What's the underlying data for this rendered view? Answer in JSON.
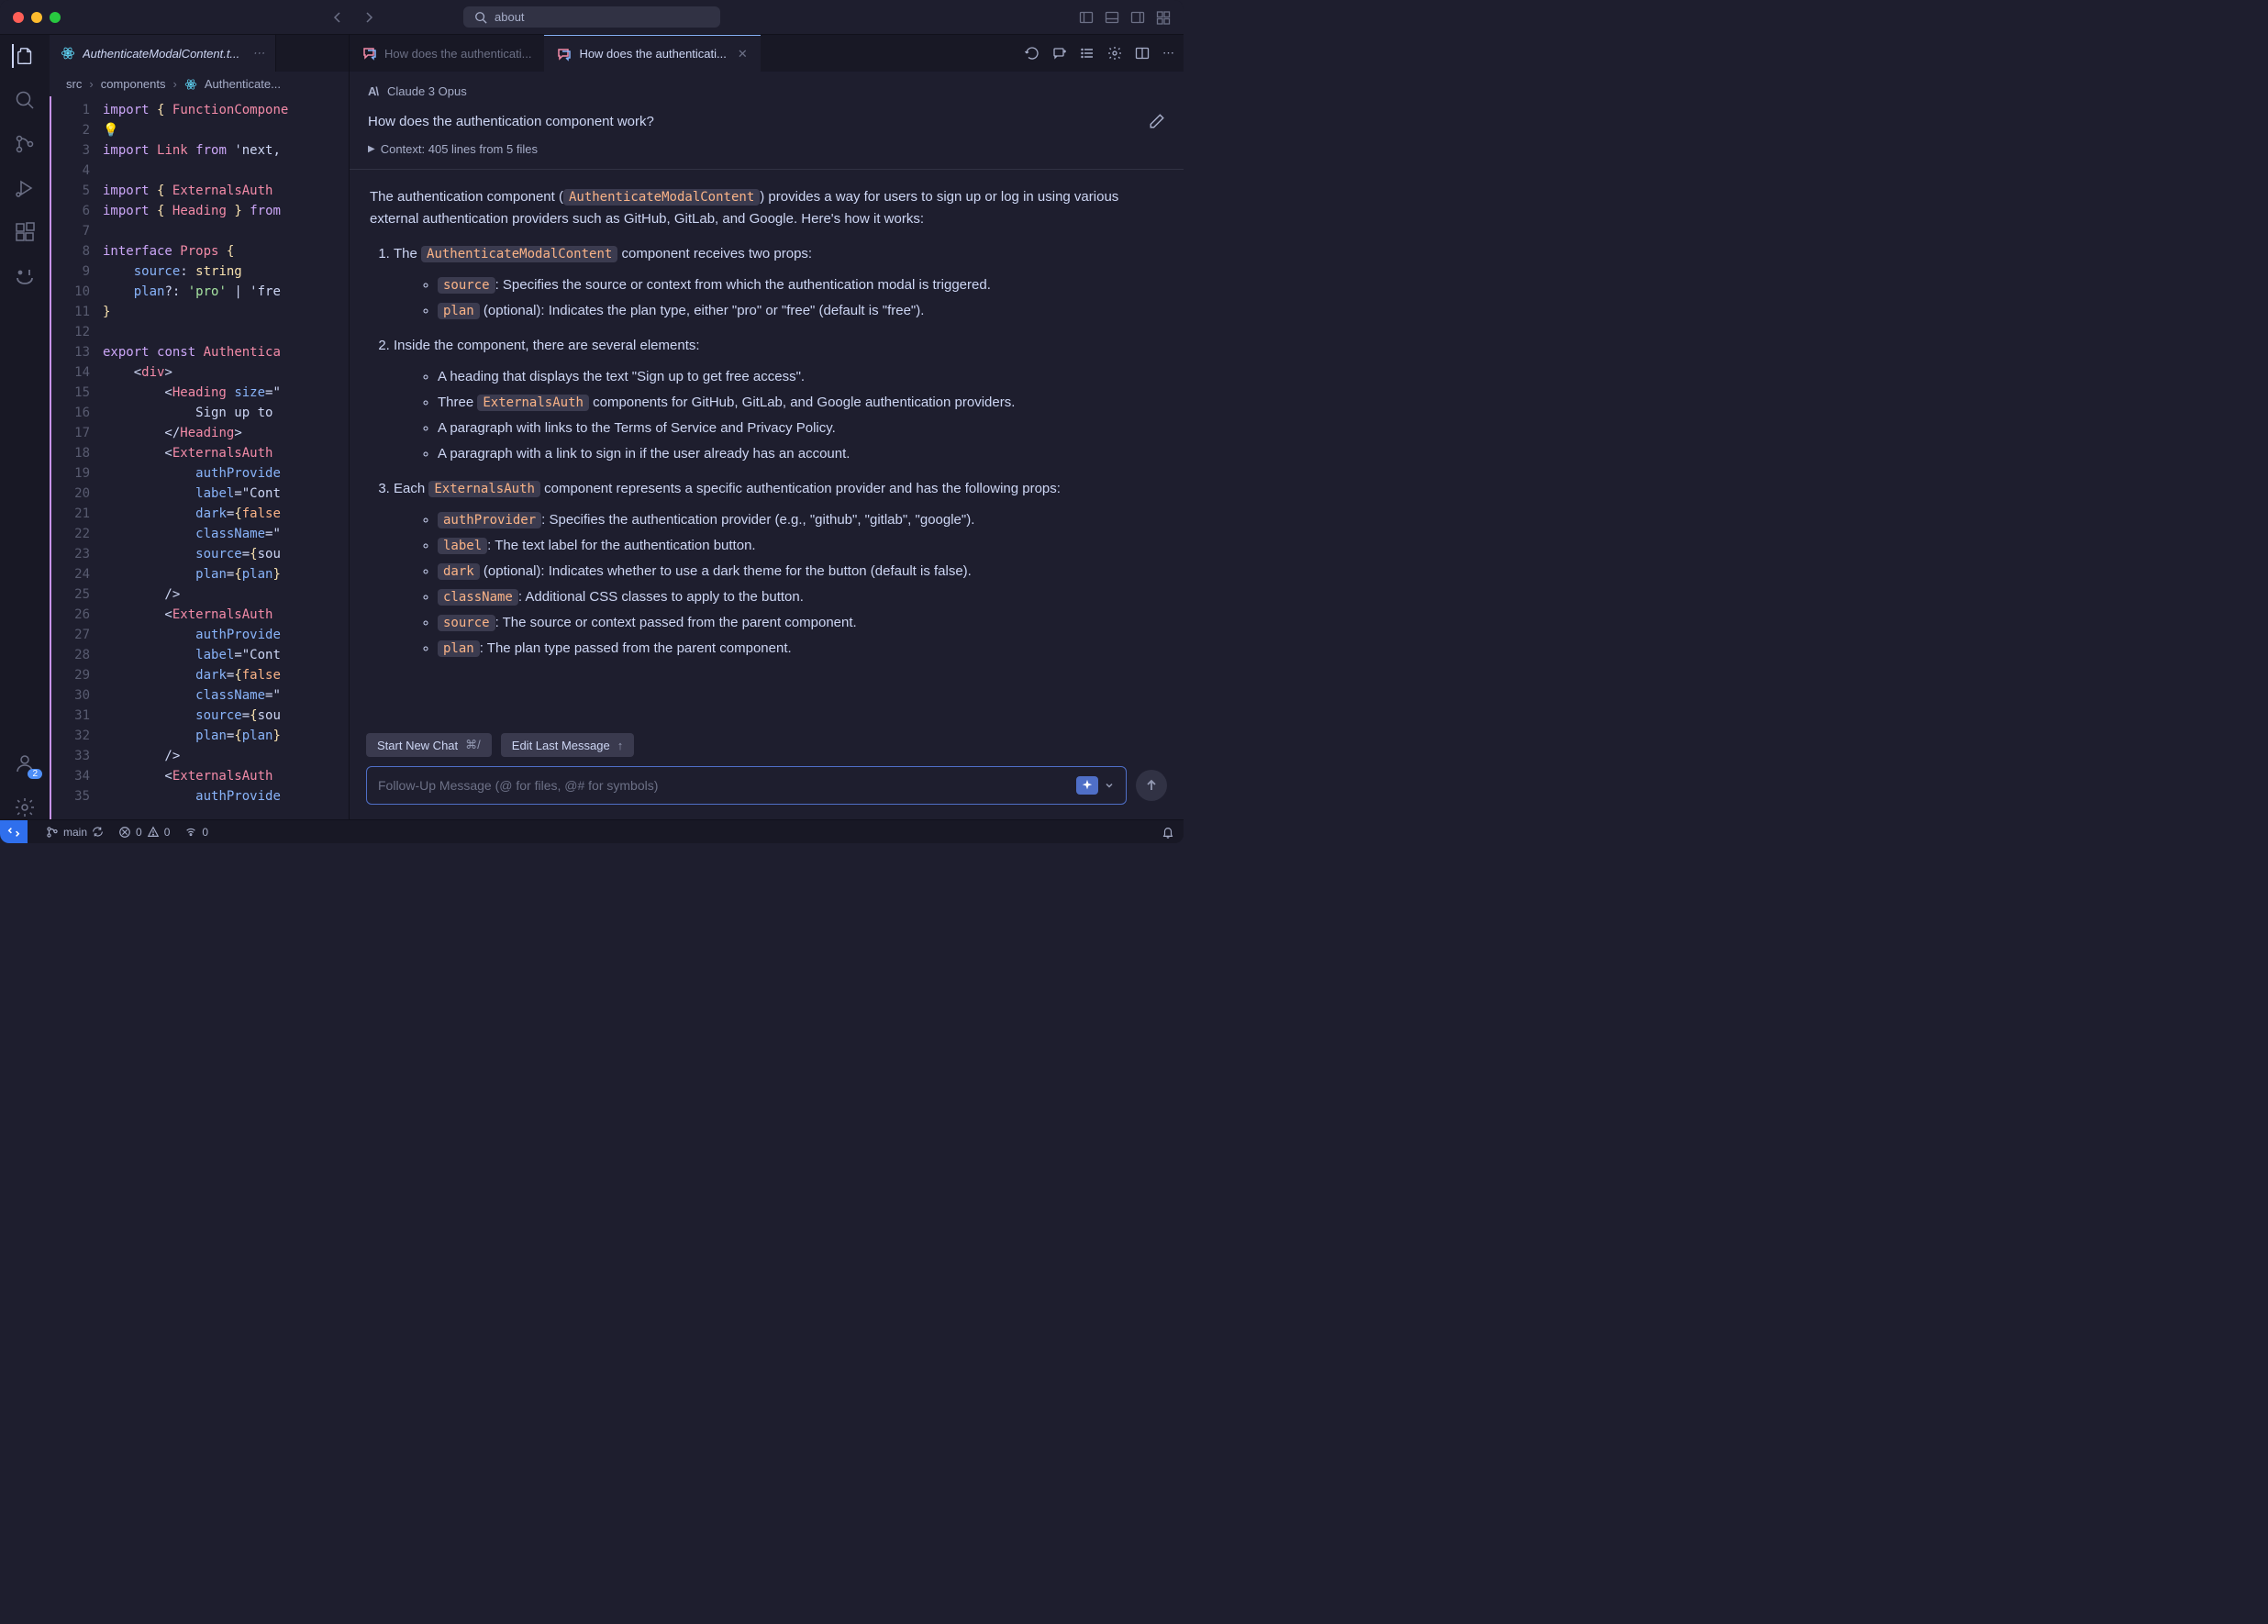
{
  "titlebar": {
    "search_value": "about"
  },
  "file_tab": {
    "label": "AuthenticateModalContent.t..."
  },
  "breadcrumb": {
    "seg1": "src",
    "seg2": "components",
    "seg3": "Authenticate..."
  },
  "code": {
    "lines": [
      "import { FunctionCompone",
      "",
      "import Link from 'next,",
      "",
      "import { ExternalsAuth",
      "import { Heading } from",
      "",
      "interface Props {",
      "    source: string",
      "    plan?: 'pro' | 'fre",
      "}",
      "",
      "export const Authentica",
      "    <div>",
      "        <Heading size=\"",
      "            Sign up to ",
      "        </Heading>",
      "        <ExternalsAuth",
      "            authProvide",
      "            label=\"Cont",
      "            dark={false",
      "            className=\"",
      "            source={sou",
      "            plan={plan}",
      "        />",
      "        <ExternalsAuth",
      "            authProvide",
      "            label=\"Cont",
      "            dark={false",
      "            className=\"",
      "            source={sou",
      "            plan={plan}",
      "        />",
      "        <ExternalsAuth",
      "            authProvide"
    ]
  },
  "chat": {
    "tabs": [
      {
        "label": "How does the authenticati..."
      },
      {
        "label": "How does the authenticati..."
      }
    ],
    "model": "Claude 3 Opus",
    "question": "How does the authentication component work?",
    "context": "Context: 405 lines from 5 files",
    "intro_pre": "The authentication component (",
    "intro_code": "AuthenticateModalContent",
    "intro_post": ") provides a way for users to sign up or log in using various external authentication providers such as GitHub, GitLab, and Google. Here's how it works:",
    "ol1_pre": "The ",
    "ol1_code": "AuthenticateModalContent",
    "ol1_post": " component receives two props:",
    "ol1_a_code": "source",
    "ol1_a_text": ": Specifies the source or context from which the authentication modal is triggered.",
    "ol1_b_code": "plan",
    "ol1_b_text": " (optional): Indicates the plan type, either \"pro\" or \"free\" (default is \"free\").",
    "ol2_text": "Inside the component, there are several elements:",
    "ol2_a": "A heading that displays the text \"Sign up to get free access\".",
    "ol2_b_pre": "Three ",
    "ol2_b_code": "ExternalsAuth",
    "ol2_b_post": " components for GitHub, GitLab, and Google authentication providers.",
    "ol2_c": "A paragraph with links to the Terms of Service and Privacy Policy.",
    "ol2_d": "A paragraph with a link to sign in if the user already has an account.",
    "ol3_pre": "Each ",
    "ol3_code": "ExternalsAuth",
    "ol3_post": " component represents a specific authentication provider and has the following props:",
    "ol3_a_code": "authProvider",
    "ol3_a_text": ": Specifies the authentication provider (e.g., \"github\", \"gitlab\", \"google\").",
    "ol3_b_code": "label",
    "ol3_b_text": ": The text label for the authentication button.",
    "ol3_c_code": "dark",
    "ol3_c_text": " (optional): Indicates whether to use a dark theme for the button (default is false).",
    "ol3_d_code": "className",
    "ol3_d_text": ": Additional CSS classes to apply to the button.",
    "ol3_e_code": "source",
    "ol3_e_text": ": The source or context passed from the parent component.",
    "ol3_f_code": "plan",
    "ol3_f_text": ": The plan type passed from the parent component.",
    "start_chat": "Start New Chat",
    "start_chat_kbd": "⌘/",
    "edit_last": "Edit Last Message",
    "edit_last_kbd": "↑",
    "input_placeholder": "Follow-Up Message (@ for files, @# for symbols)"
  },
  "status": {
    "branch": "main",
    "errors": "0",
    "warnings": "0",
    "port": "0",
    "accounts_badge": "2"
  }
}
